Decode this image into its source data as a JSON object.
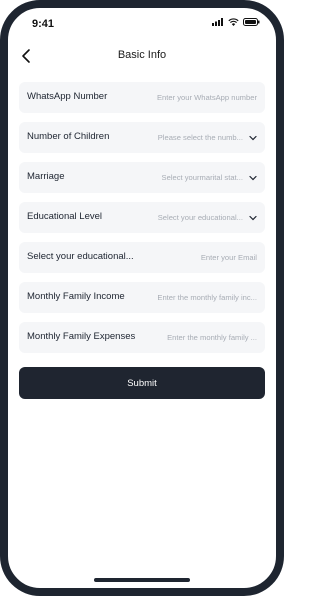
{
  "status_bar": {
    "time": "9:41",
    "icons": [
      "signal-icon",
      "wifi-icon",
      "battery-icon"
    ]
  },
  "header": {
    "title": "Basic Info",
    "back_icon": "chevron-left-icon"
  },
  "form": {
    "fields": [
      {
        "label": "WhatsApp Number",
        "placeholder": "Enter your WhatsApp number",
        "type": "input"
      },
      {
        "label": "Number of Children",
        "placeholder": "Please select the numb...",
        "type": "select"
      },
      {
        "label": "Marriage",
        "placeholder": "Select yourmarital stat...",
        "type": "select"
      },
      {
        "label": "Educational Level",
        "placeholder": "Select your educational...",
        "type": "select"
      },
      {
        "label": "Select your educational...",
        "placeholder": "Enter your Email",
        "type": "input"
      },
      {
        "label": "Monthly Family Income",
        "placeholder": "Enter the monthly family inc...",
        "type": "input"
      },
      {
        "label": "Monthly Family Expenses",
        "placeholder": "Enter the monthly family ...",
        "type": "input"
      }
    ]
  },
  "submit": {
    "label": "Submit"
  },
  "colors": {
    "primary": "#1f2530",
    "field_bg": "#f5f6f8",
    "placeholder": "#a8adb5"
  }
}
